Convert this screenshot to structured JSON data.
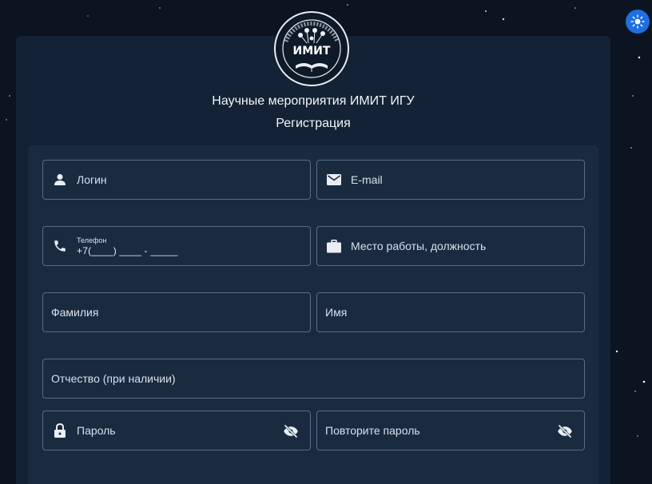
{
  "header": {
    "logo_text": "ИМИТ",
    "title": "Научные мероприятия ИМИТ ИГУ",
    "subtitle": "Регистрация"
  },
  "form": {
    "login": {
      "placeholder": "Логин",
      "icon": "user-icon"
    },
    "email": {
      "placeholder": "E-mail",
      "icon": "mail-icon"
    },
    "phone": {
      "label": "Телефон",
      "value": "+7(____) ____ - _____",
      "icon": "phone-icon"
    },
    "workplace": {
      "placeholder": "Место работы, должность",
      "icon": "briefcase-icon"
    },
    "surname": {
      "placeholder": "Фамилия"
    },
    "name": {
      "placeholder": "Имя"
    },
    "patronymic": {
      "placeholder": "Отчество (при наличии)"
    },
    "password": {
      "placeholder": "Пароль",
      "icon": "lock-icon"
    },
    "password_repeat": {
      "placeholder": "Повторите пароль"
    }
  },
  "colors": {
    "background": "#0b1420",
    "panel": "#142235",
    "card": "#1a2b40",
    "field_border": "#5b6d83",
    "accent": "#1f6fe0"
  }
}
